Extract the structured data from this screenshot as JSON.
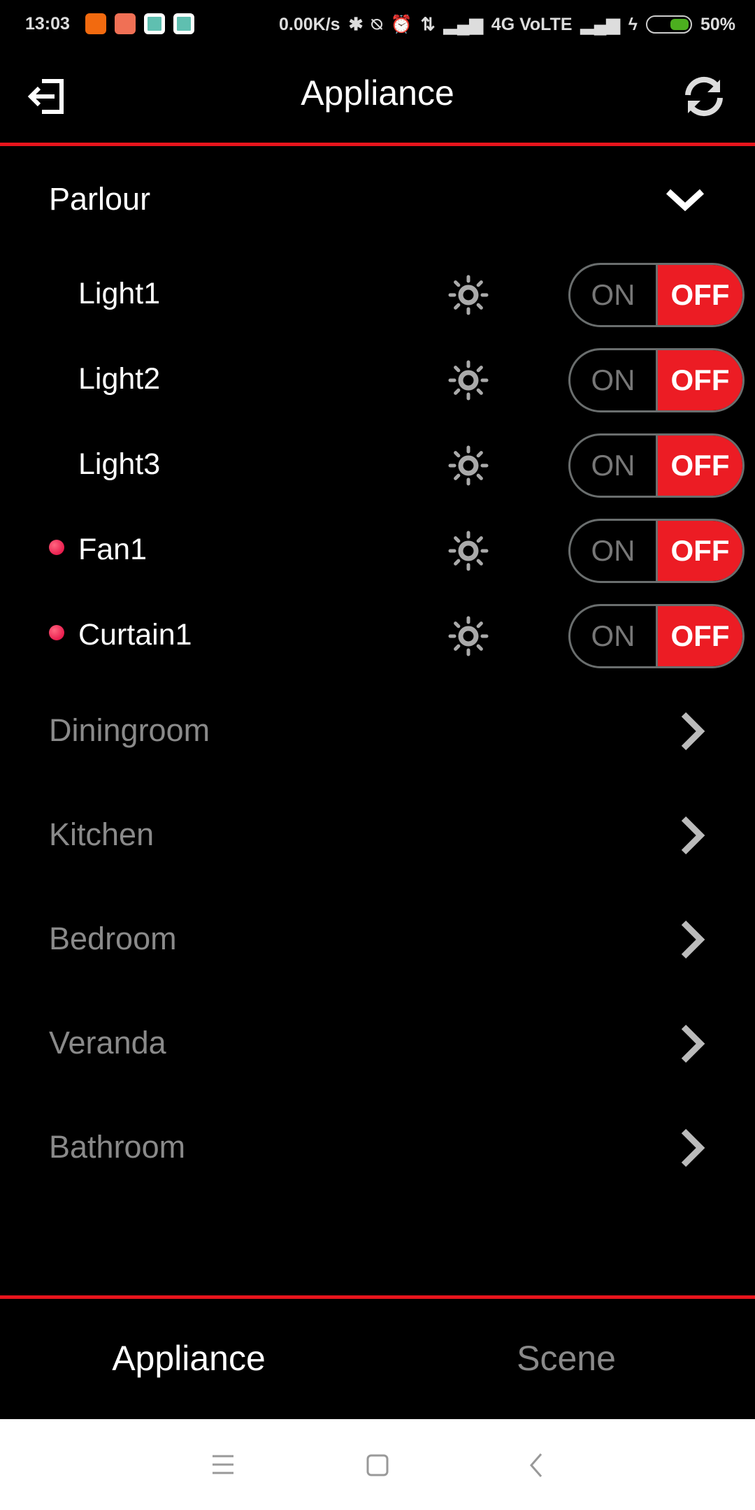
{
  "status_bar": {
    "time": "13:03",
    "net_speed": "0.00K/s",
    "network": "4G VoLTE",
    "battery": "50%",
    "battery_level": 50,
    "battery_color": "#4caf1f"
  },
  "header": {
    "title": "Appliance",
    "left_icon": "exit-icon",
    "right_icon": "refresh-icon"
  },
  "accent_color": "#e8141c",
  "expanded_group": {
    "name": "Parlour",
    "devices": [
      {
        "name": "Light1",
        "indicator": false,
        "on_label": "ON",
        "off_label": "OFF",
        "state": "off"
      },
      {
        "name": "Light2",
        "indicator": false,
        "on_label": "ON",
        "off_label": "OFF",
        "state": "off"
      },
      {
        "name": "Light3",
        "indicator": false,
        "on_label": "ON",
        "off_label": "OFF",
        "state": "off"
      },
      {
        "name": "Fan1",
        "indicator": true,
        "on_label": "ON",
        "off_label": "OFF",
        "state": "off"
      },
      {
        "name": "Curtain1",
        "indicator": true,
        "on_label": "ON",
        "off_label": "OFF",
        "state": "off"
      }
    ]
  },
  "rooms": [
    "Diningroom",
    "Kitchen",
    "Bedroom",
    "Veranda",
    "Bathroom"
  ],
  "tabs": [
    {
      "label": "Appliance",
      "active": true
    },
    {
      "label": "Scene",
      "active": false
    }
  ]
}
